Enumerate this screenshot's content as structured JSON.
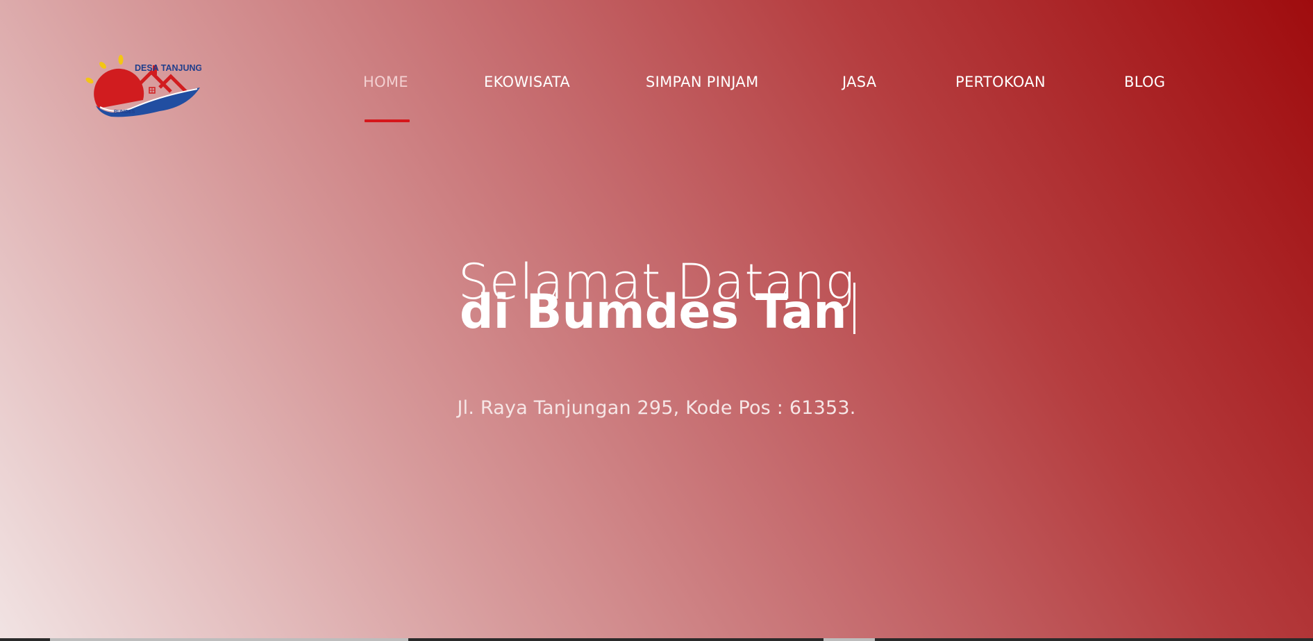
{
  "logo": {
    "top_text": "DESA TANJUNGAN",
    "bottom_text": "BUMDES"
  },
  "nav": {
    "items": [
      {
        "label": "HOME",
        "active": true
      },
      {
        "label": "EKOWISATA"
      },
      {
        "label": "SIMPAN PINJAM"
      },
      {
        "label": "JASA"
      },
      {
        "label": "PERTOKOAN"
      },
      {
        "label": "BLOG"
      }
    ]
  },
  "hero": {
    "headline_light": "Selamat Datang",
    "headline_bold": "di Bumdes Tan",
    "address": "Jl. Raya Tanjungan 295, Kode Pos : 61353."
  },
  "colors": {
    "accent": "#d6161b",
    "gradient_start": "#f1e3e3",
    "gradient_end": "#9f0c0e",
    "text": "#ffffff"
  }
}
